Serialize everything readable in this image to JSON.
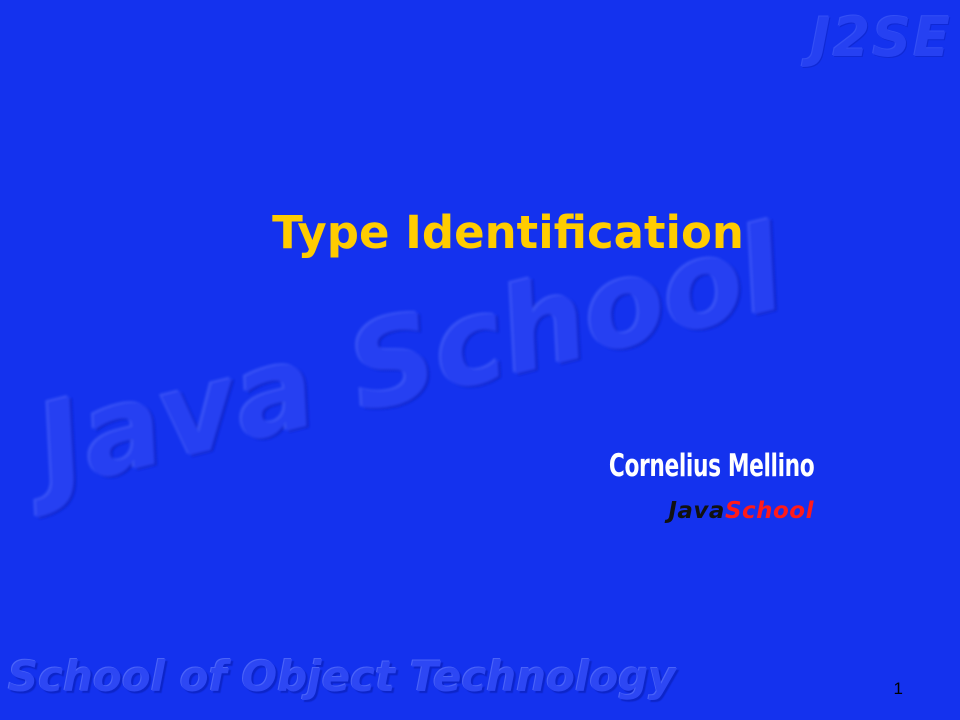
{
  "slide": {
    "title": "Type Identification",
    "author": "Cornelius Mellino",
    "brand": {
      "part1": "Java",
      "part2": "School"
    },
    "page_number": "1"
  },
  "watermarks": {
    "corner": "J2SE",
    "diagonal": "Java School",
    "footer": "School of Object Technology"
  },
  "colors": {
    "background": "#1432ee",
    "title": "#ffcc00",
    "author": "#ffffff",
    "brand_dark": "#111111",
    "brand_red": "#ff1a1a"
  }
}
